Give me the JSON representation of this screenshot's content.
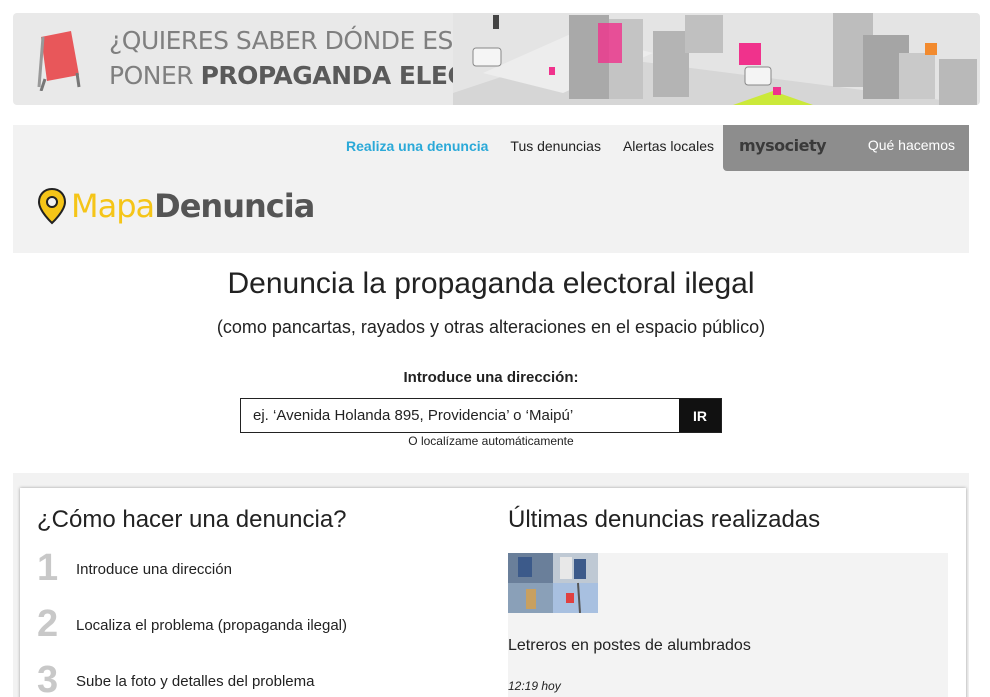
{
  "banner": {
    "line1": "¿QUIERES SABER DÓNDE ES ILEGAL",
    "line2_prefix": "PONER ",
    "line2_bold": "PROPAGANDA ELECTORAL?"
  },
  "nav": {
    "items": [
      {
        "label": "Realiza una denuncia",
        "active": true
      },
      {
        "label": "Tus denuncias",
        "active": false
      },
      {
        "label": "Alertas locales",
        "active": false
      }
    ]
  },
  "mysociety": {
    "logo": "mysociety",
    "link": "Qué hacemos"
  },
  "logo": {
    "part1": "Mapa",
    "part2": "Denuncia"
  },
  "hero": {
    "title": "Denuncia la propaganda electoral ilegal",
    "subtitle": "(como pancartas, rayados y otras alteraciones en el espacio público)",
    "label": "Introduce una dirección:",
    "placeholder": "ej. ‘Avenida Holanda 895, Providencia’ o ‘Maipú’",
    "button": "IR",
    "geolocate": "O localízame automáticamente"
  },
  "howto": {
    "title": "¿Cómo hacer una denuncia?",
    "steps": [
      {
        "num": "1",
        "text": "Introduce una dirección"
      },
      {
        "num": "2",
        "text": "Localiza el problema (propaganda ilegal)"
      },
      {
        "num": "3",
        "text": "Sube la foto y detalles del problema"
      }
    ]
  },
  "recent": {
    "title": "Últimas denuncias realizadas",
    "reports": [
      {
        "title": "Letreros en postes de alumbrados",
        "meta": "12:19 hoy"
      }
    ]
  },
  "colors": {
    "accent": "#2ba9d8",
    "logo_yellow": "#f5c518",
    "mysociety_bg": "#8d8d8d",
    "banner_pink": "#f0328c"
  }
}
